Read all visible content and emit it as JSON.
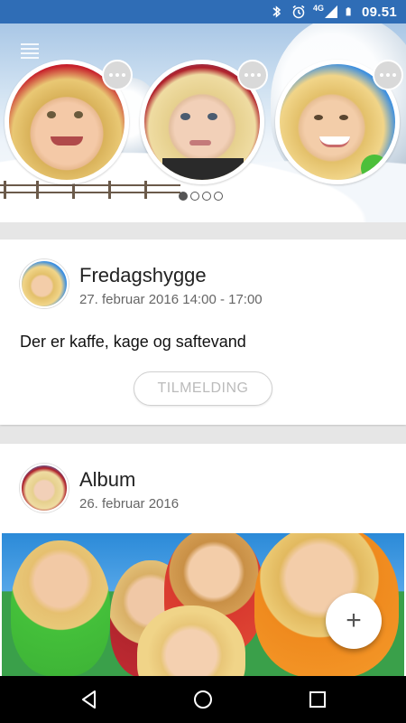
{
  "status_bar": {
    "time": "09.51",
    "network": "4G",
    "icons": [
      "bluetooth-icon",
      "alarm-icon",
      "signal-icon",
      "battery-icon"
    ],
    "color": "#2f6db6"
  },
  "hero": {
    "menu_icon": "menu-icon",
    "profiles": [
      {
        "name": "child-1",
        "more_icon": "more-icon"
      },
      {
        "name": "child-2",
        "more_icon": "more-icon"
      },
      {
        "name": "child-3",
        "more_icon": "more-icon"
      }
    ],
    "pager": {
      "pages": 4,
      "active": 0
    }
  },
  "event_card": {
    "title": "Fredagshygge",
    "subtitle": "27. februar 2016 14:00 - 17:00",
    "body": "Der er kaffe, kage og saftevand",
    "button_label": "TILMELDING"
  },
  "album_card": {
    "title": "Album",
    "subtitle": "26. februar 2016"
  },
  "fab": {
    "label": "+",
    "icon": "add-icon"
  },
  "nav_bar": {
    "icons": [
      "back-icon",
      "home-icon",
      "recents-icon"
    ]
  }
}
